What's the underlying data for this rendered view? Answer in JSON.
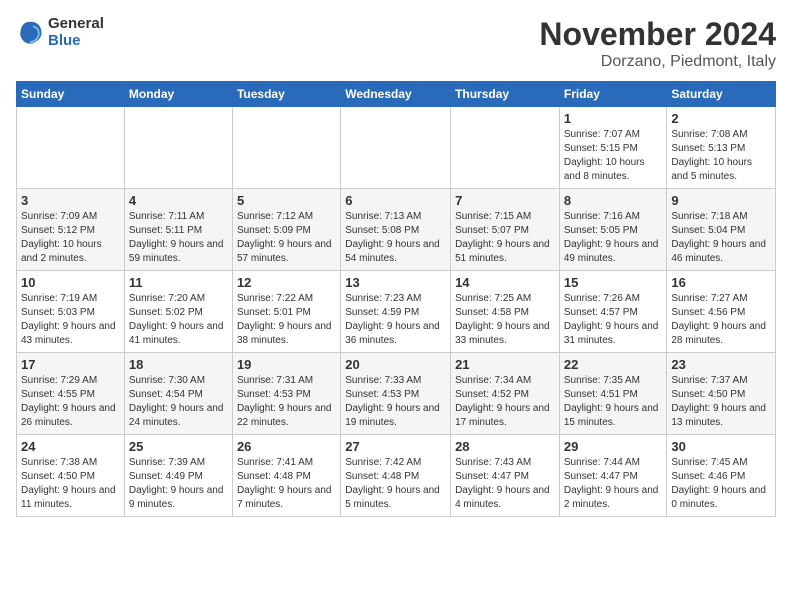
{
  "header": {
    "logo_general": "General",
    "logo_blue": "Blue",
    "month": "November 2024",
    "location": "Dorzano, Piedmont, Italy"
  },
  "weekdays": [
    "Sunday",
    "Monday",
    "Tuesday",
    "Wednesday",
    "Thursday",
    "Friday",
    "Saturday"
  ],
  "weeks": [
    [
      {
        "day": "",
        "info": ""
      },
      {
        "day": "",
        "info": ""
      },
      {
        "day": "",
        "info": ""
      },
      {
        "day": "",
        "info": ""
      },
      {
        "day": "",
        "info": ""
      },
      {
        "day": "1",
        "info": "Sunrise: 7:07 AM\nSunset: 5:15 PM\nDaylight: 10 hours and 8 minutes."
      },
      {
        "day": "2",
        "info": "Sunrise: 7:08 AM\nSunset: 5:13 PM\nDaylight: 10 hours and 5 minutes."
      }
    ],
    [
      {
        "day": "3",
        "info": "Sunrise: 7:09 AM\nSunset: 5:12 PM\nDaylight: 10 hours and 2 minutes."
      },
      {
        "day": "4",
        "info": "Sunrise: 7:11 AM\nSunset: 5:11 PM\nDaylight: 9 hours and 59 minutes."
      },
      {
        "day": "5",
        "info": "Sunrise: 7:12 AM\nSunset: 5:09 PM\nDaylight: 9 hours and 57 minutes."
      },
      {
        "day": "6",
        "info": "Sunrise: 7:13 AM\nSunset: 5:08 PM\nDaylight: 9 hours and 54 minutes."
      },
      {
        "day": "7",
        "info": "Sunrise: 7:15 AM\nSunset: 5:07 PM\nDaylight: 9 hours and 51 minutes."
      },
      {
        "day": "8",
        "info": "Sunrise: 7:16 AM\nSunset: 5:05 PM\nDaylight: 9 hours and 49 minutes."
      },
      {
        "day": "9",
        "info": "Sunrise: 7:18 AM\nSunset: 5:04 PM\nDaylight: 9 hours and 46 minutes."
      }
    ],
    [
      {
        "day": "10",
        "info": "Sunrise: 7:19 AM\nSunset: 5:03 PM\nDaylight: 9 hours and 43 minutes."
      },
      {
        "day": "11",
        "info": "Sunrise: 7:20 AM\nSunset: 5:02 PM\nDaylight: 9 hours and 41 minutes."
      },
      {
        "day": "12",
        "info": "Sunrise: 7:22 AM\nSunset: 5:01 PM\nDaylight: 9 hours and 38 minutes."
      },
      {
        "day": "13",
        "info": "Sunrise: 7:23 AM\nSunset: 4:59 PM\nDaylight: 9 hours and 36 minutes."
      },
      {
        "day": "14",
        "info": "Sunrise: 7:25 AM\nSunset: 4:58 PM\nDaylight: 9 hours and 33 minutes."
      },
      {
        "day": "15",
        "info": "Sunrise: 7:26 AM\nSunset: 4:57 PM\nDaylight: 9 hours and 31 minutes."
      },
      {
        "day": "16",
        "info": "Sunrise: 7:27 AM\nSunset: 4:56 PM\nDaylight: 9 hours and 28 minutes."
      }
    ],
    [
      {
        "day": "17",
        "info": "Sunrise: 7:29 AM\nSunset: 4:55 PM\nDaylight: 9 hours and 26 minutes."
      },
      {
        "day": "18",
        "info": "Sunrise: 7:30 AM\nSunset: 4:54 PM\nDaylight: 9 hours and 24 minutes."
      },
      {
        "day": "19",
        "info": "Sunrise: 7:31 AM\nSunset: 4:53 PM\nDaylight: 9 hours and 22 minutes."
      },
      {
        "day": "20",
        "info": "Sunrise: 7:33 AM\nSunset: 4:53 PM\nDaylight: 9 hours and 19 minutes."
      },
      {
        "day": "21",
        "info": "Sunrise: 7:34 AM\nSunset: 4:52 PM\nDaylight: 9 hours and 17 minutes."
      },
      {
        "day": "22",
        "info": "Sunrise: 7:35 AM\nSunset: 4:51 PM\nDaylight: 9 hours and 15 minutes."
      },
      {
        "day": "23",
        "info": "Sunrise: 7:37 AM\nSunset: 4:50 PM\nDaylight: 9 hours and 13 minutes."
      }
    ],
    [
      {
        "day": "24",
        "info": "Sunrise: 7:38 AM\nSunset: 4:50 PM\nDaylight: 9 hours and 11 minutes."
      },
      {
        "day": "25",
        "info": "Sunrise: 7:39 AM\nSunset: 4:49 PM\nDaylight: 9 hours and 9 minutes."
      },
      {
        "day": "26",
        "info": "Sunrise: 7:41 AM\nSunset: 4:48 PM\nDaylight: 9 hours and 7 minutes."
      },
      {
        "day": "27",
        "info": "Sunrise: 7:42 AM\nSunset: 4:48 PM\nDaylight: 9 hours and 5 minutes."
      },
      {
        "day": "28",
        "info": "Sunrise: 7:43 AM\nSunset: 4:47 PM\nDaylight: 9 hours and 4 minutes."
      },
      {
        "day": "29",
        "info": "Sunrise: 7:44 AM\nSunset: 4:47 PM\nDaylight: 9 hours and 2 minutes."
      },
      {
        "day": "30",
        "info": "Sunrise: 7:45 AM\nSunset: 4:46 PM\nDaylight: 9 hours and 0 minutes."
      }
    ]
  ]
}
